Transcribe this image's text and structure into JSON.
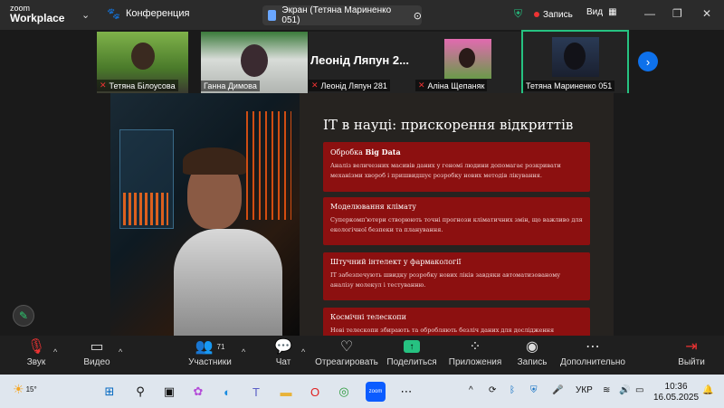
{
  "titlebar": {
    "brand_top": "zoom",
    "brand_bottom": "Workplace",
    "meeting_label": "Конференция",
    "screen_label": "Экран (Тетяна Мариненко 051)",
    "record_label": "Запись",
    "view_label": "Вид"
  },
  "gallery": {
    "participants": [
      {
        "name": "Тетяна Білоусова",
        "muted": true
      },
      {
        "name": "Ганна Димова",
        "muted": false
      },
      {
        "name": "Леонід Ляпун 281",
        "muted": true,
        "big_label": "Леонід Ляпун 2..."
      },
      {
        "name": "Аліна Щепаняк",
        "muted": true
      },
      {
        "name": "Тетяна Мариненко 051",
        "muted": false
      }
    ]
  },
  "slide": {
    "title": "IT в науці: прискорення відкриттів",
    "cards": [
      {
        "title_prefix": "Обробка ",
        "title_bold": "Big Data",
        "desc": "Аналіз величезних масивів даних у геномі людини допомагає розкривати механізми хвороб і пришвидшує розробку нових методів лікування."
      },
      {
        "title_prefix": "Моделювання клімату",
        "title_bold": "",
        "desc": "Суперкомп'ютери створюють точні прогнози кліматичних змін, що важливо для екологічної безпеки та планування."
      },
      {
        "title_prefix": "Штучний інтелект у фармакології",
        "title_bold": "",
        "desc": "ІТ забезпечують швидку розробку нових ліків завдяки автоматизованому аналізу молекул і тестуванню."
      },
      {
        "title_prefix": "Космічні телескопи",
        "title_bold": "",
        "desc": "Нові телескопи збирають та обробляють безліч даних для дослідження Всесвіту."
      }
    ]
  },
  "toolbar": {
    "audio": "Звук",
    "video": "Видео",
    "participants": "Участники",
    "participants_count": "71",
    "chat": "Чат",
    "react": "Отреагировать",
    "share": "Поделиться",
    "apps": "Приложения",
    "record": "Запись",
    "more": "Дополнительно",
    "leave": "Выйти"
  },
  "taskbar": {
    "weather": "15°",
    "lang": "УКР",
    "time": "10:36",
    "date": "16.05.2025"
  },
  "colors": {
    "accent_green": "#26c281",
    "card_red": "#8c1010",
    "mute_red": "#e33333"
  }
}
